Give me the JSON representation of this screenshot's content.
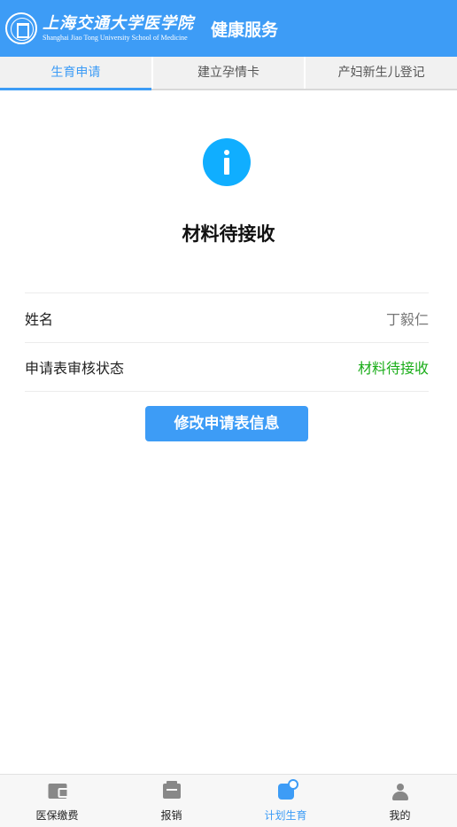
{
  "header": {
    "logo_cn": "上海交通大学医学院",
    "logo_en": "Shanghai Jiao Tong University School of Medicine",
    "title": "健康服务",
    "logo_icon": "school-seal-icon"
  },
  "tabs": [
    {
      "label": "生育申请",
      "active": true
    },
    {
      "label": "建立孕情卡",
      "active": false
    },
    {
      "label": "产妇新生儿登记",
      "active": false
    }
  ],
  "status": {
    "icon": "info-icon",
    "title": "材料待接收"
  },
  "rows": [
    {
      "label": "姓名",
      "value": "丁毅仁"
    },
    {
      "label": "申请表审核状态",
      "value": "材料待接收"
    }
  ],
  "button": {
    "label": "修改申请表信息"
  },
  "nav": [
    {
      "label": "医保缴费",
      "icon": "wallet-icon",
      "active": false
    },
    {
      "label": "报销",
      "icon": "reimburse-icon",
      "active": false
    },
    {
      "label": "计划生育",
      "icon": "family-planning-icon",
      "active": true
    },
    {
      "label": "我的",
      "icon": "user-icon",
      "active": false
    }
  ],
  "colors": {
    "brand": "#3d9cf6",
    "info": "#10aeff",
    "status_value": "#1aad19"
  }
}
